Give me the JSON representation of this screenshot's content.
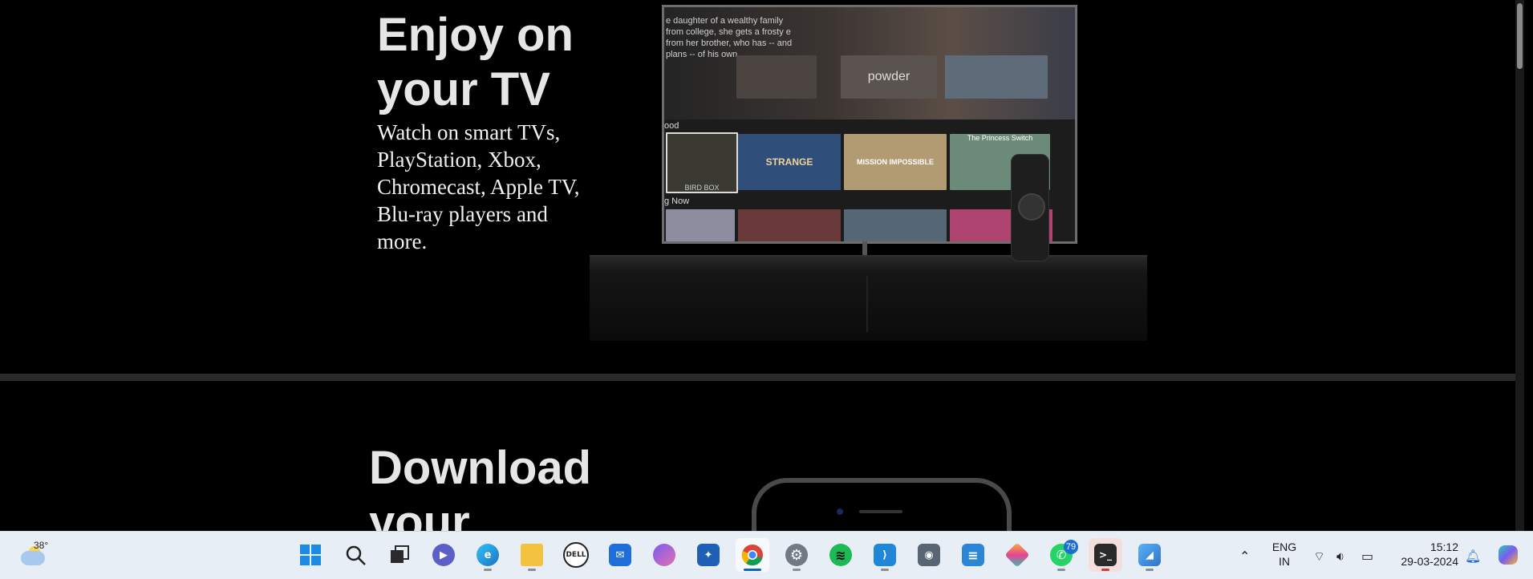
{
  "sections": {
    "tv": {
      "title": "Enjoy on your TV",
      "description": "Watch on smart TVs, PlayStation, Xbox, Chromecast, Apple TV, Blu-ray players and more.",
      "screen": {
        "hero_text": "e daughter of a wealthy family from college, she gets a frosty e from her brother, who has -- and plans -- of his own.",
        "row1_label": "ood",
        "row2_label": "g Now",
        "thumb_titles": [
          "powder",
          "STRANGE",
          "MISSION IMPOSSIBLE",
          "The Princess Switch",
          "BIRD BOX"
        ]
      }
    },
    "download": {
      "title": "Download your"
    }
  },
  "taskbar": {
    "weather": {
      "temp": "38°",
      "icon": "partly-cloudy-icon"
    },
    "apps": [
      {
        "name": "start-button",
        "icon": "windows-icon"
      },
      {
        "name": "search-button",
        "icon": "search-icon"
      },
      {
        "name": "task-view-button",
        "icon": "task-view-icon"
      },
      {
        "name": "meet-app",
        "icon": "video-chat-icon"
      },
      {
        "name": "edge-app",
        "icon": "edge-icon"
      },
      {
        "name": "file-explorer-app",
        "icon": "folder-icon"
      },
      {
        "name": "dell-app",
        "icon": "dell-icon",
        "label": "DELL"
      },
      {
        "name": "mail-app",
        "icon": "mail-icon"
      },
      {
        "name": "copilot-app",
        "icon": "copilot-icon"
      },
      {
        "name": "app-store-app",
        "icon": "store-icon"
      },
      {
        "name": "chrome-app",
        "icon": "chrome-icon"
      },
      {
        "name": "settings-app",
        "icon": "gear-icon"
      },
      {
        "name": "spotify-app",
        "icon": "spotify-icon"
      },
      {
        "name": "vscode-app",
        "icon": "vscode-icon"
      },
      {
        "name": "camera-app",
        "icon": "camera-icon"
      },
      {
        "name": "notepad-app",
        "icon": "notepad-icon"
      },
      {
        "name": "git-app",
        "icon": "git-icon"
      },
      {
        "name": "whatsapp-app",
        "icon": "whatsapp-icon",
        "badge": "79"
      },
      {
        "name": "terminal-app",
        "icon": "terminal-icon"
      },
      {
        "name": "photos-app",
        "icon": "photos-icon"
      }
    ],
    "tray": {
      "language": "ENG",
      "region": "IN",
      "time": "15:12",
      "date": "29-03-2024"
    }
  },
  "colors": {
    "page_bg": "#000000",
    "heading": "#e6e6e6",
    "taskbar_bg": "#e8eef6",
    "accent": "#0a64c8"
  }
}
